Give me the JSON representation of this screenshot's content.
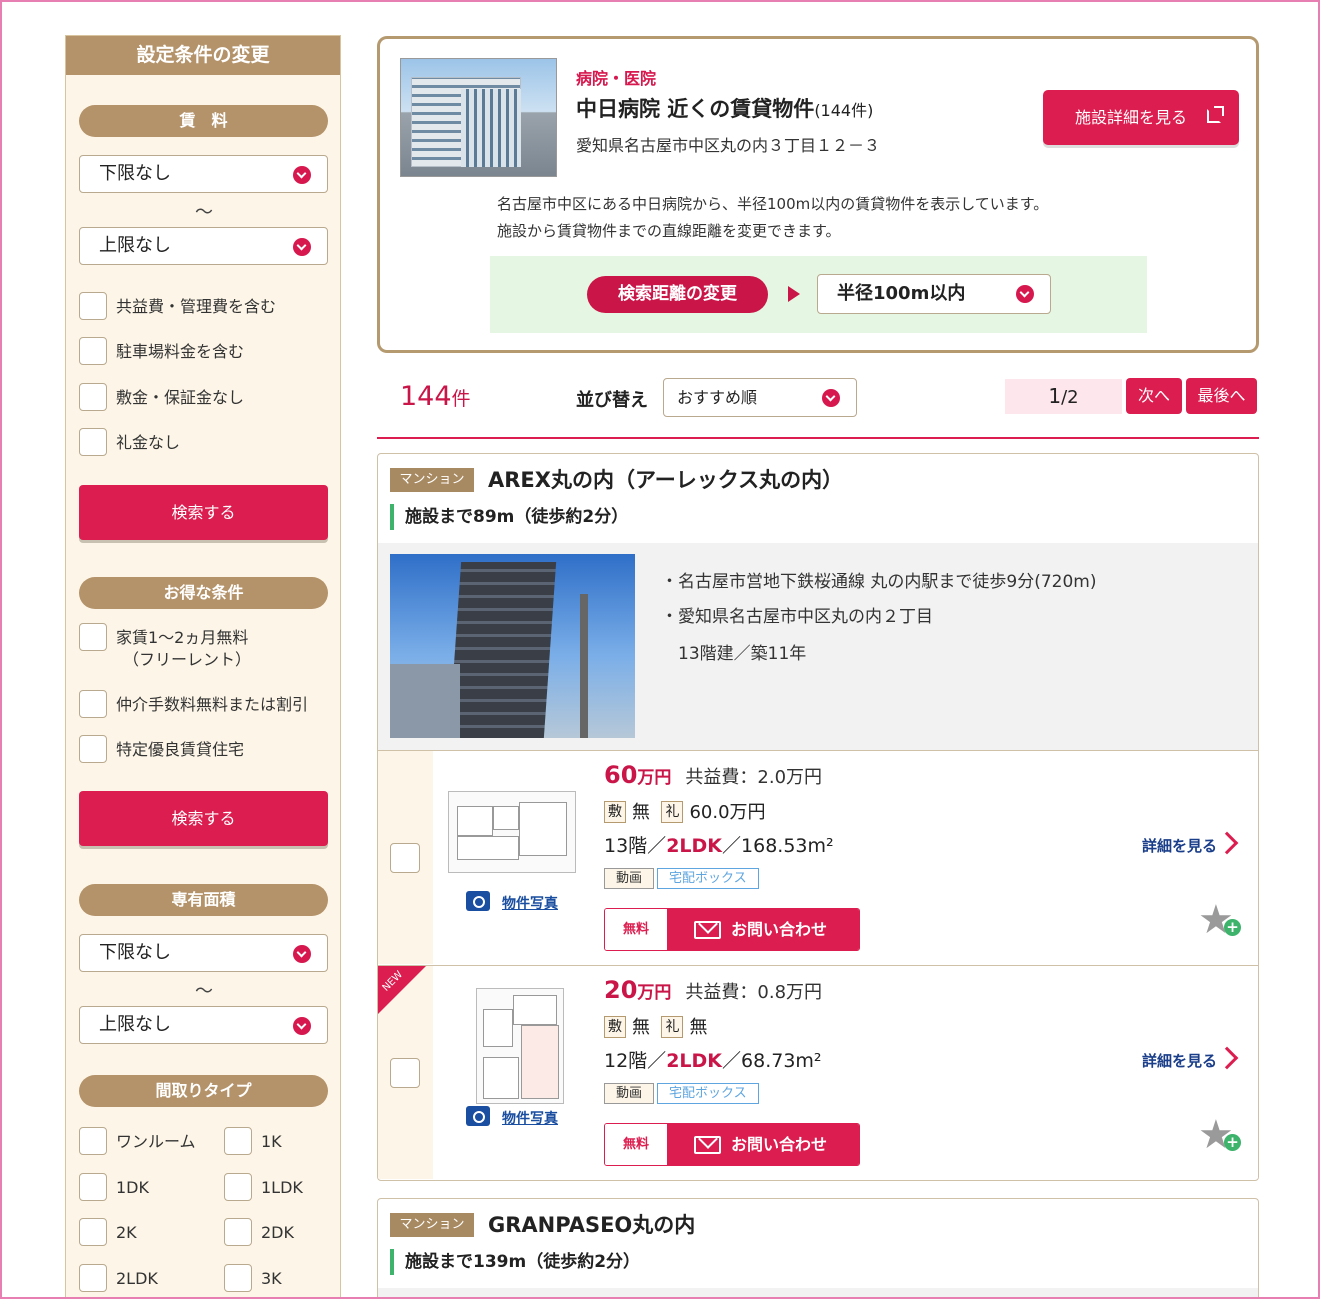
{
  "sidebar": {
    "title": "設定条件の変更",
    "rent": {
      "heading": "賃　料",
      "min": "下限なし",
      "tilde": "〜",
      "max": "上限なし",
      "options": [
        "共益費・管理費を含む",
        "駐車場料金を含む",
        "敷金・保証金なし",
        "礼金なし"
      ]
    },
    "search_label": "検索する",
    "deals": {
      "heading": "お得な条件",
      "options": [
        "家賃1〜2ヵ月無料",
        "（フリーレント）",
        "仲介手数料無料または割引",
        "特定優良賃貸住宅"
      ]
    },
    "area": {
      "heading": "専有面積",
      "min": "下限なし",
      "tilde": "〜",
      "max": "上限なし"
    },
    "layout": {
      "heading": "間取りタイプ",
      "options": [
        "ワンルーム",
        "1K",
        "1DK",
        "1LDK",
        "2K",
        "2DK",
        "2LDK",
        "3K"
      ]
    }
  },
  "facility": {
    "category": "病院・医院",
    "title": "中日病院 近くの賃貸物件",
    "count": "(144件)",
    "address": "愛知県名古屋市中区丸の内３丁目１２－３",
    "detail_button": "施設詳細を見る",
    "desc_line1": "名古屋市中区にある中日病院から、半径100m以内の賃貸物件を表示しています。",
    "desc_line2": "施設から賃貸物件までの直線距離を変更できます。",
    "distance_label": "検索距離の変更",
    "distance_value": "半径100m以内"
  },
  "results": {
    "count": "144",
    "count_unit": "件",
    "sort_label": "並び替え",
    "sort_value": "おすすめ順",
    "page_current": "1",
    "page_total": "/2",
    "next": "次へ",
    "last": "最後へ"
  },
  "properties": [
    {
      "type_tag": "マンション",
      "name": "AREX丸の内（アーレックス丸の内）",
      "distance": "施設まで89m（徒歩約2分）",
      "station": "・名古屋市営地下鉄桜通線 丸の内駅まで徒歩9分(720m)",
      "address": "・愛知県名古屋市中区丸の内２丁目",
      "building": "13階建／築11年",
      "rooms": [
        {
          "rent": "60",
          "rent_unit": "万円",
          "fee": "共益費：2.0万円",
          "deposit_k": "敷",
          "deposit_v": "無",
          "key_k": "礼",
          "key_v": "60.0万円",
          "floor": "13階／",
          "layout": "2LDK",
          "area": "／168.53m²",
          "badge1": "動画",
          "badge2": "宅配ボックス",
          "photo_link": "物件写真",
          "free": "無料",
          "inquiry": "お問い合わせ",
          "detail": "詳細を見る",
          "is_new": false
        },
        {
          "rent": "20",
          "rent_unit": "万円",
          "fee": "共益費：0.8万円",
          "deposit_k": "敷",
          "deposit_v": "無",
          "key_k": "礼",
          "key_v": "無",
          "floor": "12階／",
          "layout": "2LDK",
          "area": "／68.73m²",
          "badge1": "動画",
          "badge2": "宅配ボックス",
          "photo_link": "物件写真",
          "free": "無料",
          "inquiry": "お問い合わせ",
          "detail": "詳細を見る",
          "is_new": true,
          "new_label": "NEW"
        }
      ]
    },
    {
      "type_tag": "マンション",
      "name": "GRANPASEO丸の内",
      "distance": "施設まで139m（徒歩約2分）"
    }
  ],
  "colors": {
    "accent": "#dc1d4f",
    "beige": "#b4936a",
    "panel_bg": "#fdf6e8",
    "green_bg": "#e5f6e2"
  }
}
